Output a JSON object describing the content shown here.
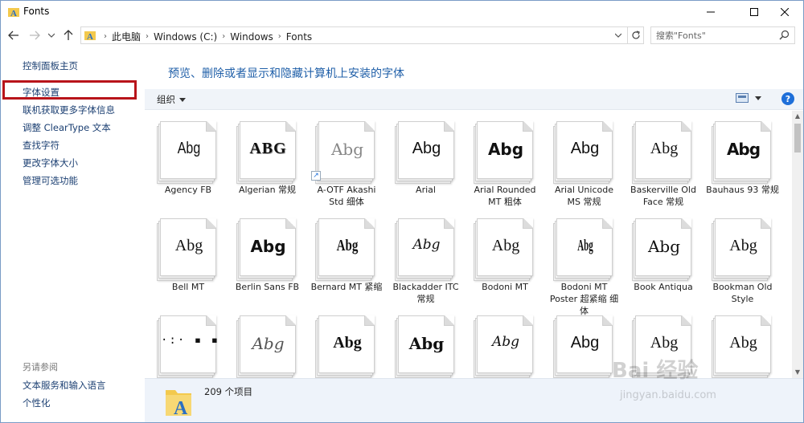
{
  "window": {
    "title": "Fonts"
  },
  "nav": {
    "breadcrumbs": [
      "此电脑",
      "Windows (C:)",
      "Windows",
      "Fonts"
    ],
    "search_placeholder": "搜索\"Fonts\""
  },
  "sidebar": {
    "links": [
      "控制面板主页",
      "字体设置",
      "联机获取更多字体信息",
      "调整 ClearType 文本",
      "查找字符",
      "更改字体大小",
      "管理可选功能"
    ],
    "see_also_title": "另请参阅",
    "see_also_links": [
      "文本服务和输入语言",
      "个性化"
    ]
  },
  "main": {
    "title": "预览、删除或者显示和隐藏计算机上安装的字体",
    "organize_label": "组织",
    "help_label": "?"
  },
  "fonts": [
    {
      "name": "Agency FB",
      "sample": "Abg"
    },
    {
      "name": "Algerian 常规",
      "sample": "ABG"
    },
    {
      "name": "A-OTF Akashi Std 细体",
      "sample": "Abg",
      "shortcut": true
    },
    {
      "name": "Arial",
      "sample": "Abg"
    },
    {
      "name": "Arial Rounded MT 粗体",
      "sample": "Abg"
    },
    {
      "name": "Arial Unicode MS 常规",
      "sample": "Abg"
    },
    {
      "name": "Baskerville Old Face 常规",
      "sample": "Abg"
    },
    {
      "name": "Bauhaus 93 常规",
      "sample": "Abg"
    },
    {
      "name": "Bell MT",
      "sample": "Abg"
    },
    {
      "name": "Berlin Sans FB",
      "sample": "Abg"
    },
    {
      "name": "Bernard MT 紧缩",
      "sample": "Abg"
    },
    {
      "name": "Blackadder ITC 常规",
      "sample": "Abg"
    },
    {
      "name": "Bodoni MT",
      "sample": "Abg"
    },
    {
      "name": "Bodoni MT Poster 超紧缩 细体",
      "sample": "Abg"
    },
    {
      "name": "Book Antiqua",
      "sample": "Abg"
    },
    {
      "name": "Bookman Old Style",
      "sample": "Abg"
    },
    {
      "name": "",
      "sample": "·:· ▪ ▪"
    },
    {
      "name": "",
      "sample": "Abg"
    },
    {
      "name": "",
      "sample": "Abg"
    },
    {
      "name": "",
      "sample": "Abg"
    },
    {
      "name": "",
      "sample": "Abg"
    },
    {
      "name": "",
      "sample": "Abg"
    },
    {
      "name": "",
      "sample": "Abg"
    },
    {
      "name": "",
      "sample": "Abg"
    }
  ],
  "status": {
    "item_count": "209 个项目"
  },
  "watermark": {
    "text": "Bai 经验",
    "sub": "jingyan.baidu.com"
  },
  "colors": {
    "accent": "#1f5fa8",
    "highlight": "#b8141a",
    "details_bg": "#eef3fa"
  }
}
